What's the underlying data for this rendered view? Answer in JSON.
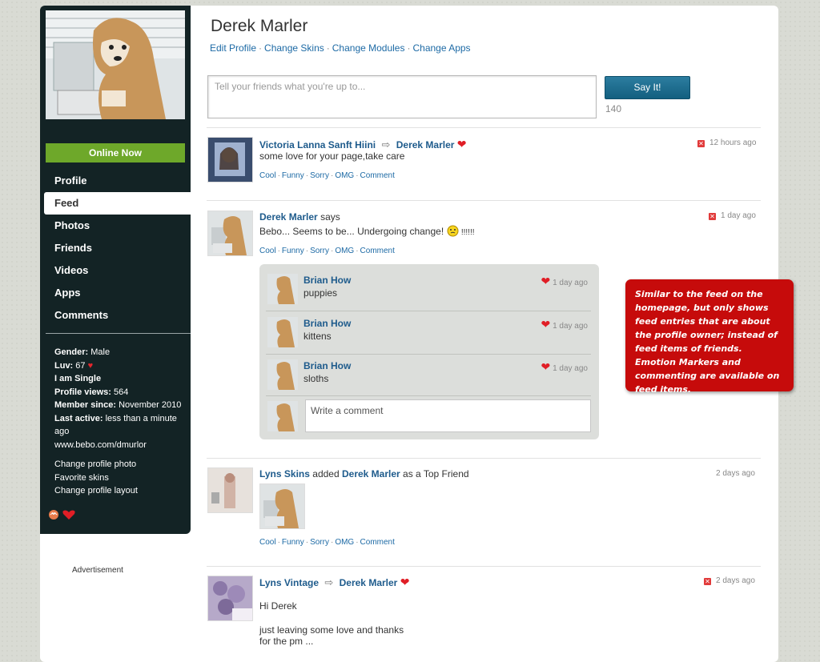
{
  "profile": {
    "name": "Derek Marler",
    "online": "Online Now",
    "links": [
      "Edit Profile",
      "Change Skins",
      "Change Modules",
      "Change Apps"
    ]
  },
  "nav": [
    "Profile",
    "Feed",
    "Photos",
    "Friends",
    "Videos",
    "Apps",
    "Comments"
  ],
  "stats": {
    "gender_label": "Gender:",
    "gender": "Male",
    "luv_label": "Luv:",
    "luv": "67",
    "single": "I am Single",
    "views_label": "Profile views:",
    "views": "564",
    "member_label": "Member since:",
    "member": "November 2010",
    "active_label": "Last active:",
    "active": "less than a minute ago",
    "url": "www.bebo.com/dmurlor"
  },
  "side_links": [
    "Change profile photo",
    "Favorite skins",
    "Change profile layout"
  ],
  "ad": "Advertisement",
  "status": {
    "placeholder": "Tell your friends what you're up to...",
    "button": "Say It!",
    "counter": "140"
  },
  "actions": [
    "Cool",
    "Funny",
    "Sorry",
    "OMG",
    "Comment"
  ],
  "feed": [
    {
      "from": "Victoria Lanna Sanft Hiini",
      "to": "Derek Marler",
      "text": "some love for your page,take care",
      "time": "12 hours ago"
    },
    {
      "from": "Derek Marler",
      "says": "says",
      "text": "Bebo... Seems to be... Undergoing change!",
      "text_after": "!!!!!!",
      "time": "1 day ago"
    },
    {
      "from": "Lyns Skins",
      "verb": "added",
      "to": "Derek Marler",
      "tail": "as a Top Friend",
      "time": "2 days ago"
    },
    {
      "from": "Lyns Vintage",
      "to": "Derek Marler",
      "line1": "Hi Derek",
      "line2": "just leaving some love and thanks",
      "line3": "for the pm ...",
      "time": "2 days ago"
    }
  ],
  "comments": [
    {
      "name": "Brian How",
      "text": "puppies",
      "time": "1 day ago"
    },
    {
      "name": "Brian How",
      "text": "kittens",
      "time": "1 day ago"
    },
    {
      "name": "Brian How",
      "text": "sloths",
      "time": "1 day ago"
    }
  ],
  "comment_placeholder": "Write a comment",
  "callout": "Similar to the feed on the homepage, but only shows feed entries that are about the profile owner; instead of feed items of friends. Emotion Markers and commenting are available on feed items."
}
